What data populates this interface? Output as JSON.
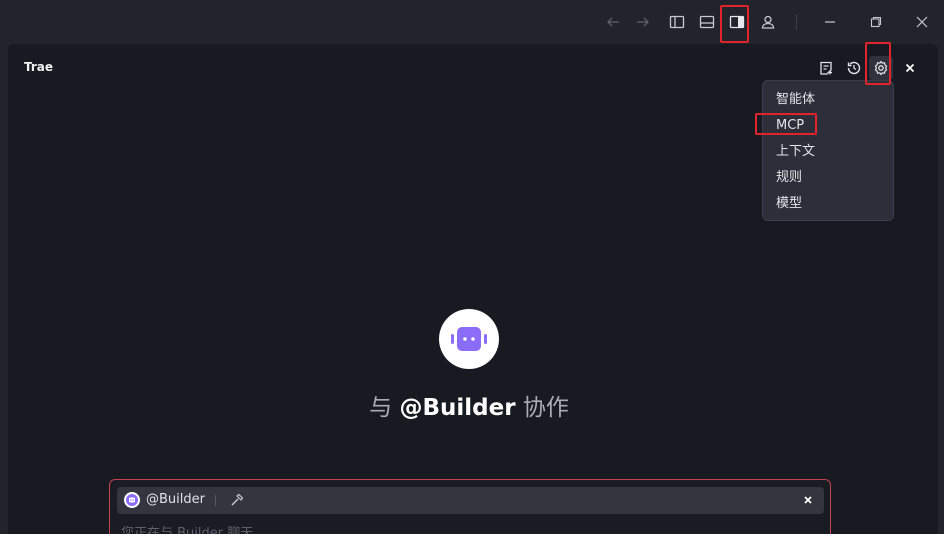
{
  "panel": {
    "title": "Trae"
  },
  "settings_menu": {
    "items": [
      "智能体",
      "MCP",
      "上下文",
      "规则",
      "模型"
    ]
  },
  "welcome": {
    "prefix": "与 ",
    "agent": "@Builder",
    "suffix": " 协作"
  },
  "chat": {
    "agent_label": "@Builder",
    "placeholder": "您正在与 Builder 聊天"
  },
  "icons": {
    "titlebar": [
      "back-arrow-icon",
      "forward-arrow-icon",
      "left-panel-toggle-icon",
      "bottom-panel-toggle-icon",
      "right-panel-toggle-icon",
      "account-icon",
      "minimize-icon",
      "restore-icon",
      "close-window-icon"
    ],
    "panel": [
      "new-chat-icon",
      "history-icon",
      "settings-gear-icon",
      "close-panel-icon"
    ]
  },
  "colors": {
    "highlight": "#e0242b",
    "accent_purple": "#8b6cf6",
    "background": "#22242c",
    "panel": "#181a21"
  }
}
